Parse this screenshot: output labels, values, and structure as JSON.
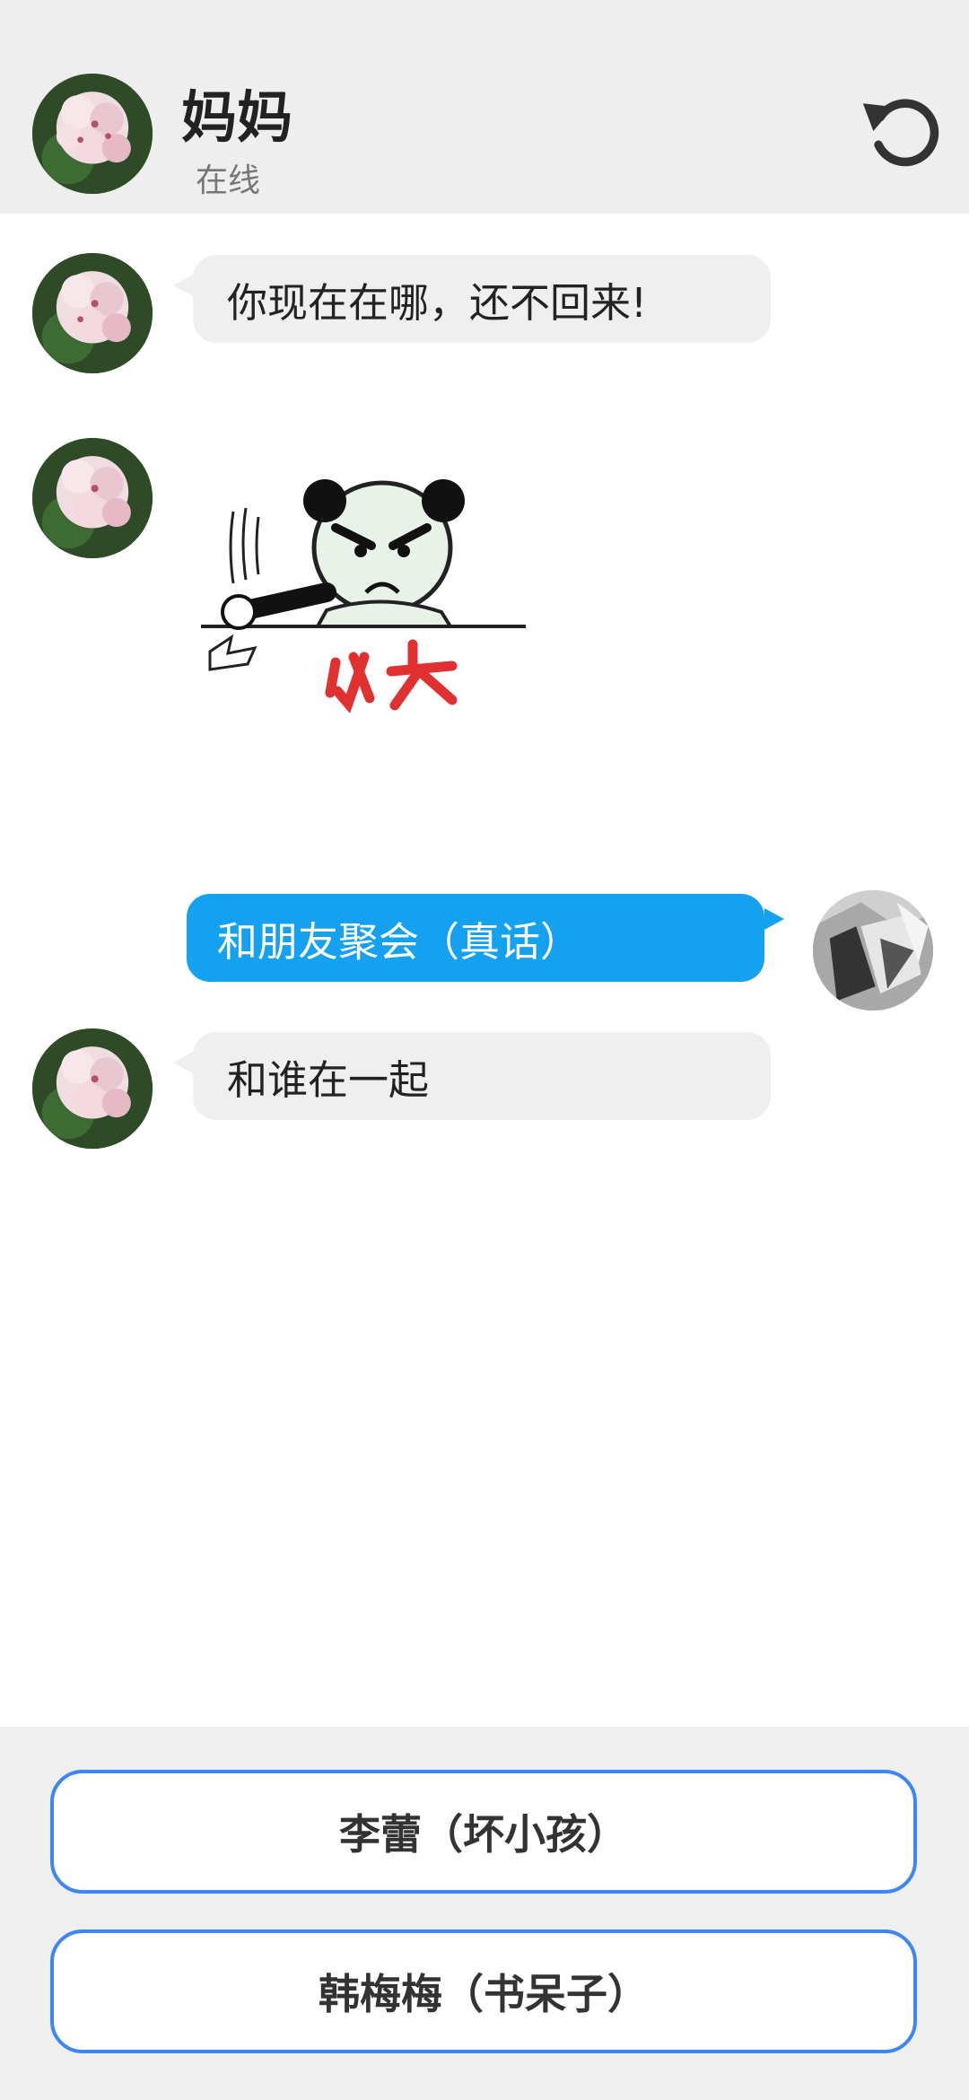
{
  "header": {
    "name": "妈妈",
    "status": "在线",
    "refresh_icon": "refresh-icon"
  },
  "messages": [
    {
      "from": "mom",
      "type": "text",
      "text": "你现在在哪，还不回来!"
    },
    {
      "from": "mom",
      "type": "sticker",
      "sticker_text": "火大"
    },
    {
      "from": "me",
      "type": "text",
      "text": "和朋友聚会（真话）"
    },
    {
      "from": "mom",
      "type": "text",
      "text": "和谁在一起"
    }
  ],
  "choices": [
    {
      "label": "李蕾（坏小孩）"
    },
    {
      "label": "韩梅梅（书呆子）"
    }
  ],
  "colors": {
    "accent_blue": "#13a1f0",
    "choice_border": "#3d86f6",
    "incoming_bubble": "#efefef",
    "header_bg": "#eeeeee"
  }
}
